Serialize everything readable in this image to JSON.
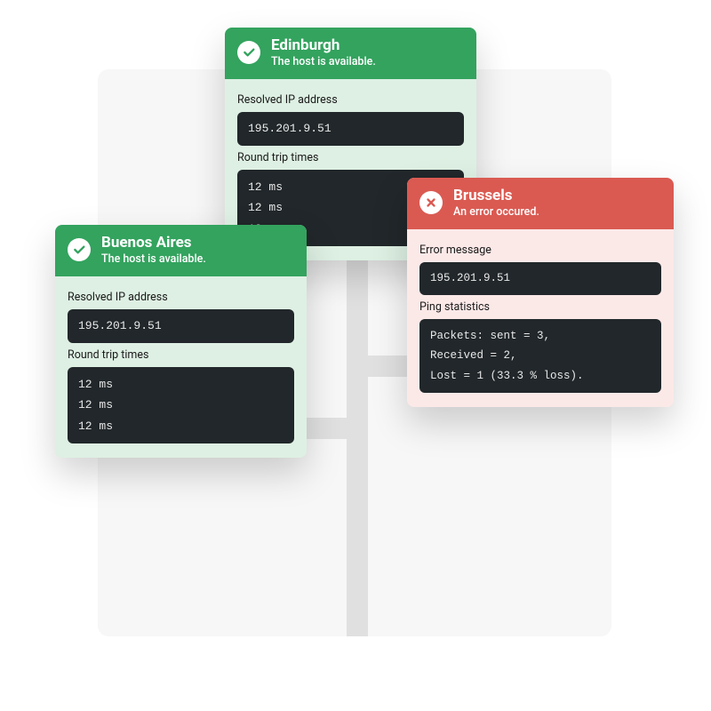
{
  "labels": {
    "resolved_ip": "Resolved IP address",
    "rtt": "Round trip times",
    "error_msg": "Error message",
    "ping_stats": "Ping statistics"
  },
  "cards": {
    "edinburgh": {
      "title": "Edinburgh",
      "subtitle": "The host is available.",
      "ip": "195.201.9.51",
      "rtt": "12 ms\n12 ms\n12 ms"
    },
    "buenos": {
      "title": "Buenos Aires",
      "subtitle": "The host is available.",
      "ip": "195.201.9.51",
      "rtt": "12 ms\n12 ms\n12 ms"
    },
    "brussels": {
      "title": "Brussels",
      "subtitle": "An error occured.",
      "ip": "195.201.9.51",
      "stats": "Packets: sent = 3,\nReceived = 2,\nLost = 1 (33.3 % loss)."
    }
  }
}
